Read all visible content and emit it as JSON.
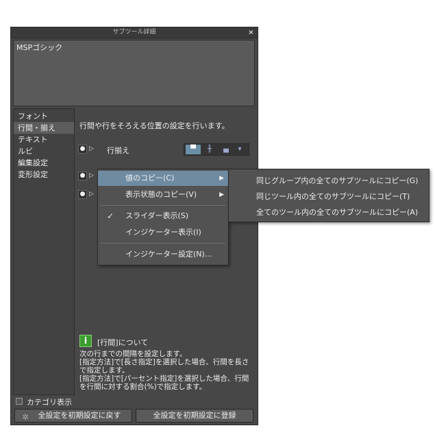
{
  "window": {
    "title": "サブツール詳細",
    "close": "×"
  },
  "font_name": "MSPゴシック",
  "categories": [
    "フォント",
    "行間・揃え",
    "テキスト",
    "ルビ",
    "編集設定",
    "変形設定"
  ],
  "selected_category": 1,
  "description": "行間や行をそろえる位置の設定を行います。",
  "row1": {
    "label": "行揃え"
  },
  "menu": {
    "items": [
      {
        "label": "値のコピー(C)",
        "has_sub": true,
        "highlighted": true
      },
      {
        "label": "表示状態のコピー(V)",
        "has_sub": true
      },
      {
        "label": "スライダー表示(S)",
        "checked": true
      },
      {
        "label": "インジケーター表示(I)"
      },
      {
        "label": "インジケーター設定(N)..."
      }
    ]
  },
  "submenu": {
    "items": [
      "同じグループ内の全てのサブツールにコピー(G)",
      "同じツール内の全てのサブツールにコピー(T)",
      "全てのツール内の全てのサブツールにコピー(A)"
    ]
  },
  "info": {
    "icon": "i",
    "title": "[行間]について",
    "body": [
      "次の行までの間隔を設定します。",
      "[指定方法]で[長さ指定]を選択した場合、行間を長さで指定します。",
      "[指定方法]で[パーセント指定]を選択した場合、行間を行間に対する割合(%)で指定します。"
    ]
  },
  "category_toggle": "カテゴリ表示",
  "buttons": {
    "reset": "全設定を初期設定に戻す",
    "register": "全設定を初期設定に登録"
  },
  "colors": {
    "panel": "#474747",
    "highlight": "#6f8ba2",
    "info_icon": "#3a9d2e"
  }
}
